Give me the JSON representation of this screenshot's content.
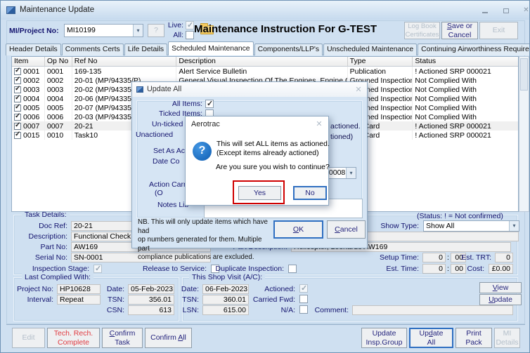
{
  "window": {
    "title": "Maintenance Update"
  },
  "header": {
    "project_label": "MI/Project No:",
    "project_value": "MI10199",
    "help_button": "?",
    "live_label": "Live:",
    "live_checked": true,
    "all_label": "All:",
    "all_checked": false,
    "title": "Maintenance Instruction For G-TEST",
    "logbook_line1": "Log Book",
    "logbook_line2": "Certificates",
    "save_line1": "&Save or",
    "save_line2": "Cancel",
    "exit_button": "Exit"
  },
  "tabs": [
    {
      "label": "Header Details"
    },
    {
      "label": "Comments & Certs"
    },
    {
      "label": "Life Details"
    },
    {
      "label": "Scheduled Maintenance"
    },
    {
      "label": "Components/LLP's"
    },
    {
      "label": "Unscheduled Maintenance"
    },
    {
      "label": "Continuing Airworthiness Requirements"
    }
  ],
  "table": {
    "columns": [
      "Item",
      "Op No",
      "Ref No",
      "Description",
      "Type",
      "Status"
    ],
    "rows": [
      {
        "checked": true,
        "item": "0001",
        "op": "0001",
        "ref": "169-135",
        "desc": "Alert Service Bulletin",
        "type": "Publication",
        "status": "! Actioned SRP 000021"
      },
      {
        "checked": true,
        "item": "0002",
        "op": "0002",
        "ref": "20-01 (MP/94335/P)",
        "desc": "General Visual Inspection Of The Engines, Engine Com...",
        "type": "Grouned Inspection",
        "status": "Not Complied With"
      },
      {
        "checked": true,
        "item": "0003",
        "op": "0003",
        "ref": "20-02 (MP/94335/P)",
        "desc": "",
        "type": "Grouned Inspection",
        "status": "Not Complied With"
      },
      {
        "checked": true,
        "item": "0004",
        "op": "0004",
        "ref": "20-06 (MP/94335/P)",
        "desc": "",
        "type": "Grouned Inspection",
        "status": "Not Complied With"
      },
      {
        "checked": true,
        "item": "0005",
        "op": "0005",
        "ref": "20-07 (MP/94335/P)",
        "desc": "",
        "type": "Grouned Inspection",
        "status": "Not Complied With"
      },
      {
        "checked": true,
        "item": "0006",
        "op": "0006",
        "ref": "20-03 (MP/94335/P)",
        "desc": "",
        "type": "Grouned Inspection",
        "status": "Not Complied With"
      },
      {
        "checked": true,
        "item": "0007",
        "op": "0007",
        "ref": "20-21",
        "desc": "",
        "type": "Job Card",
        "status": "! Actioned SRP 000021"
      },
      {
        "checked": true,
        "item": "0015",
        "op": "0010",
        "ref": "Task10",
        "desc": "",
        "type": "Job Card",
        "status": "! Actioned SRP 000021"
      }
    ]
  },
  "update_all": {
    "title": "Update All",
    "all_items_label": "All Items:",
    "all_items_checked": true,
    "ticked_items_label": "Ticked Items:",
    "ticked_items_checked": false,
    "unticked_fragment": "Un-ticked",
    "unactioned_fragment": "Unactioned",
    "set_as_fragment": "Set As Ac",
    "date_fragment": "Date Co",
    "action_fragment": "Action Carrie",
    "op_fragment": "(O",
    "notes_fragment": "Notes Lib",
    "right_fragment1": "actioned.",
    "right_fragment2": "tioned)",
    "engineer_value": "AGM0008E",
    "nb_text": "NB. This will only update items which have had\nop numbers generated for them. Multiple part\ncompliance publications are excluded.",
    "ok_button": "&OK",
    "cancel_button": "&Cancel"
  },
  "confirm": {
    "title": "Aerotrac",
    "icon": "?",
    "message_line1": "This will set ALL items as actioned.",
    "message_line2": "(Except items already actioned)",
    "question": "Are you sure you wish to continue?",
    "yes_button": "Yes",
    "no_button": "No"
  },
  "task": {
    "group_label": "Task Details:",
    "status_note": "(Status: ! = Not confirmed)",
    "doc_ref_label": "Doc Ref:",
    "doc_ref": "20-21",
    "show_type_label": "Show Type:",
    "show_type": "Show All",
    "description_label": "Description:",
    "description": "Functional Check (Continuity Check)  Of The Bonding Cables Of Th",
    "part_no_label": "Part No:",
    "part_no": "AW169",
    "part_description_label": "Part Description:",
    "part_description": "Helicopter, Leonardo AW169",
    "serial_no_label": "Serial No:",
    "serial_no": "SN-0001",
    "inspection_stage_label": "Inspection Stage:",
    "inspection_stage_checked": true,
    "release_label": "Release to Service:",
    "release_checked": false,
    "duplicate_label": "Duplicate Inspection:",
    "duplicate_checked": false,
    "setup_time_label": "Setup Time:",
    "setup_h": "0",
    "setup_m": "00",
    "est_trt_label": "Est. TRT:",
    "est_trt": "0",
    "est_time_label": "Est. Time:",
    "est_h": "0",
    "est_m": "00",
    "cost_label": "Cost:",
    "cost": "£0.00",
    "colon": ":"
  },
  "last_complied": {
    "group_label": "Last Complied With:",
    "project_label": "Project No:",
    "project": "HP10628",
    "date_label": "Date:",
    "date": "05-Feb-2023",
    "interval_label": "Interval:",
    "interval": "Repeat",
    "tsn_label": "TSN:",
    "tsn": "356.01",
    "csn_label": "CSN:",
    "csn": "613"
  },
  "shop_visit": {
    "group_label": "This Shop Visit (A/C):",
    "date_label": "Date:",
    "date": "06-Feb-2023",
    "actioned_label": "Actioned:",
    "actioned_checked": true,
    "tsn_label": "TSN:",
    "tsn": "360.01",
    "carried_label": "Carried Fwd:",
    "carried_checked": false,
    "lsn_label": "LSN:",
    "lsn": "615.00",
    "na_label": "N/A:",
    "na_checked": false,
    "comment_label": "Comment:",
    "comment": "",
    "view_button": "&View",
    "update_button": "&Update"
  },
  "bottom": {
    "edit": "Edit",
    "tech_line1": "Tech. Rech.",
    "tech_line2": "Complete",
    "confirm_task_line1": "&Confirm",
    "confirm_task_line2": "Task",
    "confirm_all": "Confirm &All",
    "update_group_line1": "Update",
    "update_group_line2": "Insp.Group",
    "update_all_line1": "Up&date",
    "update_all_line2": "All",
    "print_line1": "Print",
    "print_line2": "Pack",
    "mi_line1": "MI",
    "mi_line2": "Details"
  },
  "colors": {
    "window_bg": "#cfe0f1",
    "highlight_red": "#cf0000",
    "focus_blue": "#2f6fc1",
    "warning_text_red": "#e03a40"
  }
}
